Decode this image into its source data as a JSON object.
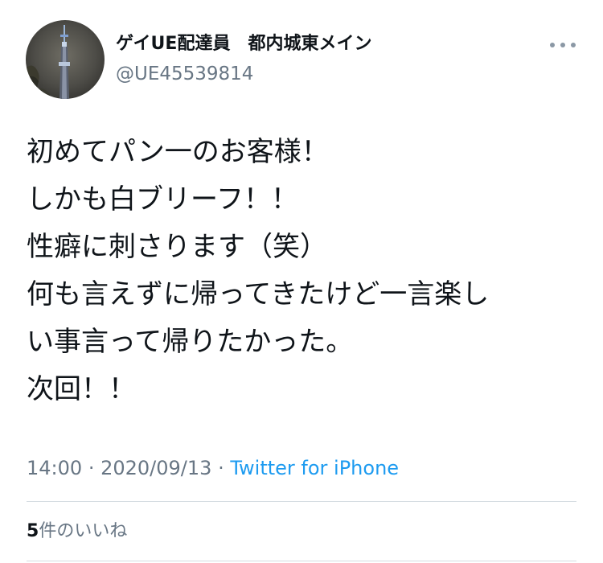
{
  "author": {
    "display_name": "ゲイUE配達員　都内城東メイン",
    "handle": "@UE45539814"
  },
  "tweet": {
    "lines": [
      "初めてパン一のお客様！",
      "しかも白ブリーフ！！",
      "性癖に刺さります（笑）",
      "何も言えずに帰ってきたけど一言楽し",
      "い事言って帰りたかった。",
      "次回！！"
    ],
    "time": "14:00",
    "date": "2020/09/13",
    "separator": "·",
    "source": "Twitter for iPhone"
  },
  "stats": {
    "likes_count": "5",
    "likes_label": "件のいいね"
  },
  "colors": {
    "text": "#0f1419",
    "secondary": "#687684",
    "link": "#1d9bf0",
    "divider": "#d5dce1"
  },
  "icons": {
    "more": "more-horizontal-icon"
  }
}
